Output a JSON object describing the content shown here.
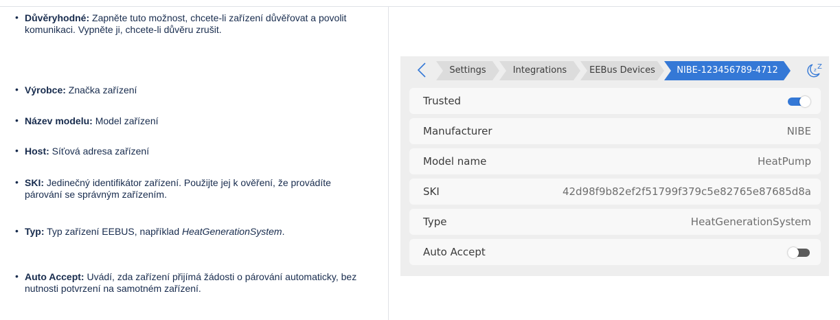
{
  "docs": {
    "items": [
      {
        "term": "Důvěryhodné:",
        "desc": " Zapněte tuto možnost, chcete-li zařízení důvěřovat a povolit komunikaci. Vypněte ji, chcete-li důvěru zrušit."
      },
      {
        "term": "Výrobce:",
        "desc": " Značka zařízení"
      },
      {
        "term": "Název modelu:",
        "desc": " Model zařízení"
      },
      {
        "term": "Host:",
        "desc": " Síťová adresa zařízení"
      },
      {
        "term": "SKI:",
        "desc": " Jedinečný identifikátor zařízení. Použijte jej k ověření, že provádíte párování se správným zařízením."
      },
      {
        "term": "Typ:",
        "desc": " Typ zařízení EEBUS, například ",
        "desc_italic": "HeatGenerationSystem",
        "desc_end": "."
      },
      {
        "term": "Auto Accept:",
        "desc": " Uvádí, zda zařízení přijímá žádosti o párování automaticky, bez nutnosti potvrzení na samotném zařízení."
      }
    ]
  },
  "device_panel": {
    "breadcrumbs": [
      "Settings",
      "Integrations",
      "EEBus Devices",
      "NIBE-123456789-4712"
    ],
    "icons": {
      "back": "chevron-left-icon",
      "sleep": "sleep-zz-icon"
    },
    "rows": {
      "trusted": {
        "label": "Trusted",
        "on": true
      },
      "manufacturer": {
        "label": "Manufacturer",
        "value": "NIBE"
      },
      "model_name": {
        "label": "Model name",
        "value": "HeatPump"
      },
      "ski": {
        "label": "SKI",
        "value": "42d98f9b82ef2f51799f379c5e82765e87685d8a"
      },
      "type": {
        "label": "Type",
        "value": "HeatGenerationSystem"
      },
      "auto_accept": {
        "label": "Auto Accept",
        "on": false
      }
    },
    "colors": {
      "accent": "#3478d6",
      "crumb_bg": "#dcdcdc",
      "panel_bg": "#eeeeee",
      "row_bg": "#f8f8f8"
    }
  }
}
